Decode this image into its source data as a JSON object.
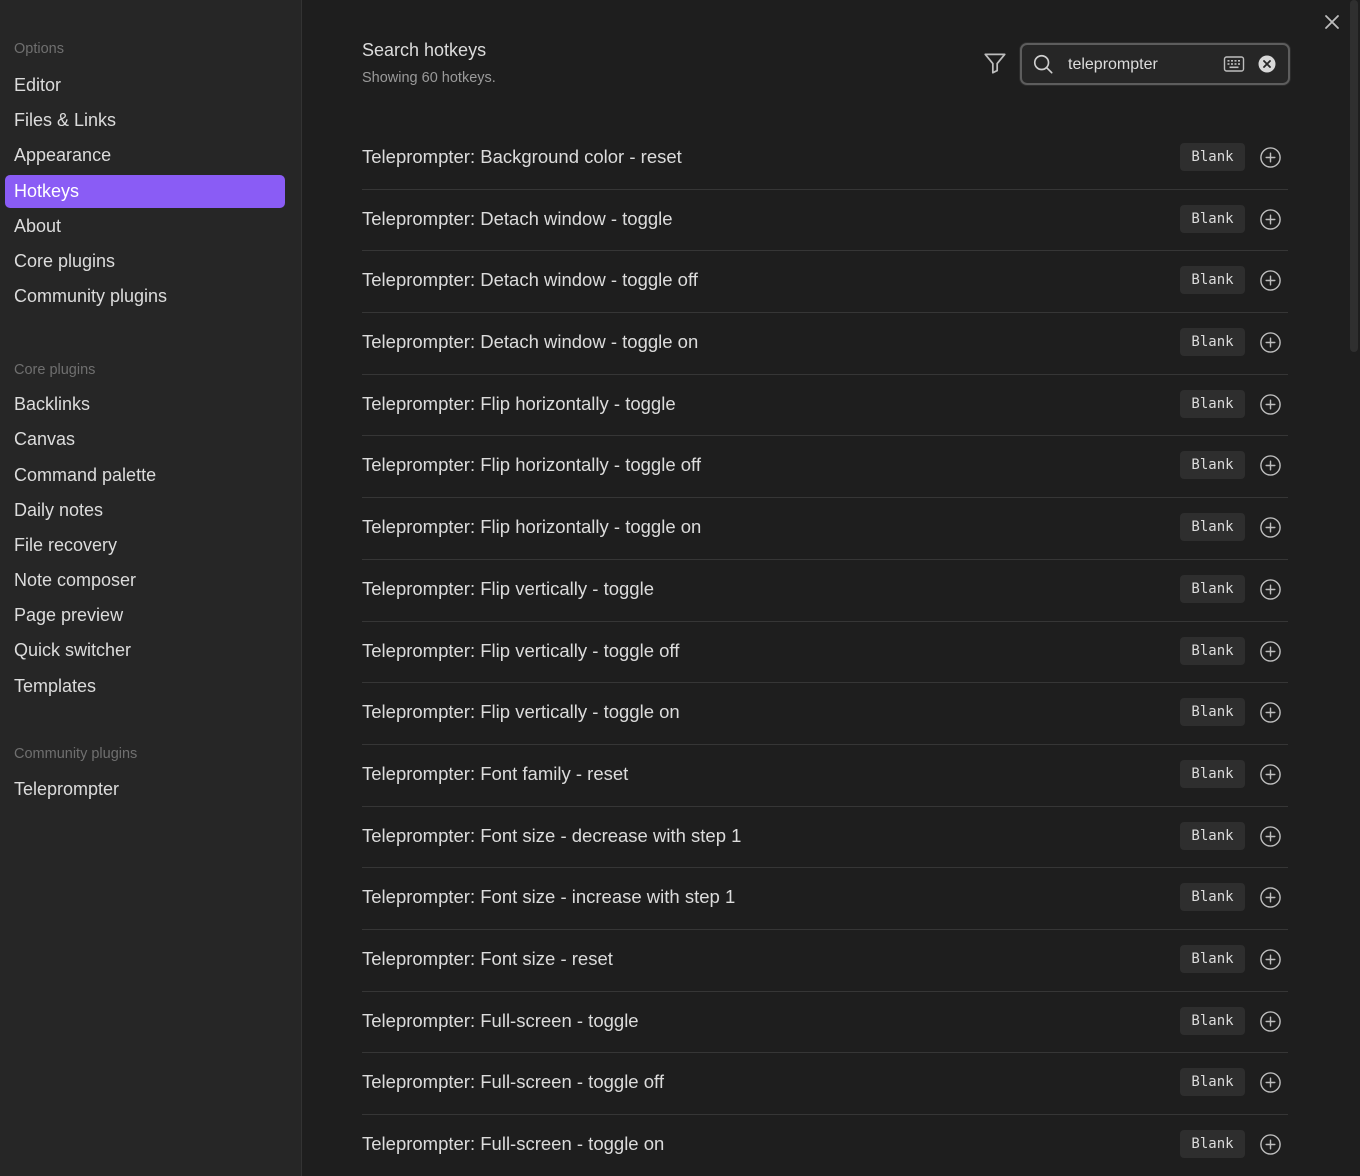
{
  "sidebar": {
    "options_title": "Options",
    "options": [
      {
        "label": "Editor",
        "active": false
      },
      {
        "label": "Files & Links",
        "active": false
      },
      {
        "label": "Appearance",
        "active": false
      },
      {
        "label": "Hotkeys",
        "active": true
      },
      {
        "label": "About",
        "active": false
      },
      {
        "label": "Core plugins",
        "active": false
      },
      {
        "label": "Community plugins",
        "active": false
      }
    ],
    "core_title": "Core plugins",
    "core": [
      {
        "label": "Backlinks"
      },
      {
        "label": "Canvas"
      },
      {
        "label": "Command palette"
      },
      {
        "label": "Daily notes"
      },
      {
        "label": "File recovery"
      },
      {
        "label": "Note composer"
      },
      {
        "label": "Page preview"
      },
      {
        "label": "Quick switcher"
      },
      {
        "label": "Templates"
      }
    ],
    "community_title": "Community plugins",
    "community": [
      {
        "label": "Teleprompter"
      }
    ]
  },
  "header": {
    "title": "Search hotkeys",
    "subtitle": "Showing 60 hotkeys."
  },
  "search": {
    "value": "teleprompter"
  },
  "hotkeys": [
    {
      "label": "Teleprompter: Background color - reset",
      "hotkey": "Blank"
    },
    {
      "label": "Teleprompter: Detach window - toggle",
      "hotkey": "Blank"
    },
    {
      "label": "Teleprompter: Detach window - toggle off",
      "hotkey": "Blank"
    },
    {
      "label": "Teleprompter: Detach window - toggle on",
      "hotkey": "Blank"
    },
    {
      "label": "Teleprompter: Flip horizontally - toggle",
      "hotkey": "Blank"
    },
    {
      "label": "Teleprompter: Flip horizontally - toggle off",
      "hotkey": "Blank"
    },
    {
      "label": "Teleprompter: Flip horizontally - toggle on",
      "hotkey": "Blank"
    },
    {
      "label": "Teleprompter: Flip vertically - toggle",
      "hotkey": "Blank"
    },
    {
      "label": "Teleprompter: Flip vertically - toggle off",
      "hotkey": "Blank"
    },
    {
      "label": "Teleprompter: Flip vertically - toggle on",
      "hotkey": "Blank"
    },
    {
      "label": "Teleprompter: Font family - reset",
      "hotkey": "Blank"
    },
    {
      "label": "Teleprompter: Font size - decrease with step 1",
      "hotkey": "Blank"
    },
    {
      "label": "Teleprompter: Font size - increase with step 1",
      "hotkey": "Blank"
    },
    {
      "label": "Teleprompter: Font size - reset",
      "hotkey": "Blank"
    },
    {
      "label": "Teleprompter: Full-screen - toggle",
      "hotkey": "Blank"
    },
    {
      "label": "Teleprompter: Full-screen - toggle off",
      "hotkey": "Blank"
    },
    {
      "label": "Teleprompter: Full-screen - toggle on",
      "hotkey": "Blank"
    }
  ],
  "colors": {
    "accent": "#8a5cf5",
    "background": "#1e1e1e",
    "sidebar": "#262626"
  }
}
